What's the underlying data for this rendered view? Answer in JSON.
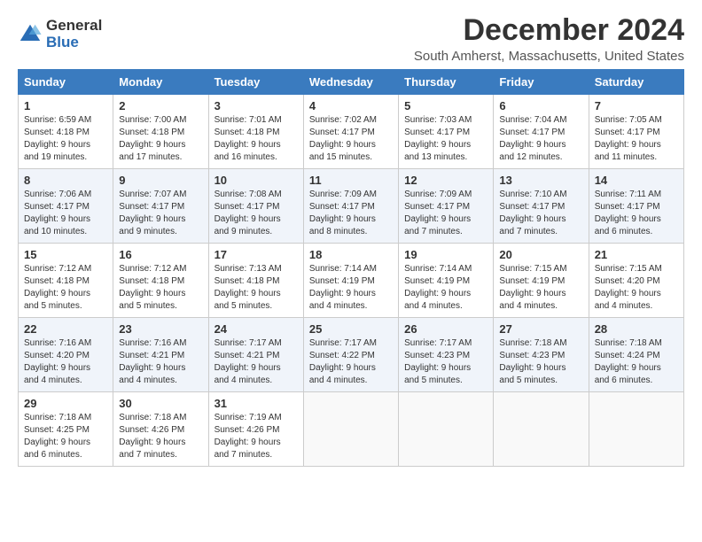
{
  "logo": {
    "general": "General",
    "blue": "Blue"
  },
  "title": "December 2024",
  "location": "South Amherst, Massachusetts, United States",
  "days_of_week": [
    "Sunday",
    "Monday",
    "Tuesday",
    "Wednesday",
    "Thursday",
    "Friday",
    "Saturday"
  ],
  "weeks": [
    [
      {
        "day": "1",
        "sunrise": "6:59 AM",
        "sunset": "4:18 PM",
        "daylight": "9 hours and 19 minutes."
      },
      {
        "day": "2",
        "sunrise": "7:00 AM",
        "sunset": "4:18 PM",
        "daylight": "9 hours and 17 minutes."
      },
      {
        "day": "3",
        "sunrise": "7:01 AM",
        "sunset": "4:18 PM",
        "daylight": "9 hours and 16 minutes."
      },
      {
        "day": "4",
        "sunrise": "7:02 AM",
        "sunset": "4:17 PM",
        "daylight": "9 hours and 15 minutes."
      },
      {
        "day": "5",
        "sunrise": "7:03 AM",
        "sunset": "4:17 PM",
        "daylight": "9 hours and 13 minutes."
      },
      {
        "day": "6",
        "sunrise": "7:04 AM",
        "sunset": "4:17 PM",
        "daylight": "9 hours and 12 minutes."
      },
      {
        "day": "7",
        "sunrise": "7:05 AM",
        "sunset": "4:17 PM",
        "daylight": "9 hours and 11 minutes."
      }
    ],
    [
      {
        "day": "8",
        "sunrise": "7:06 AM",
        "sunset": "4:17 PM",
        "daylight": "9 hours and 10 minutes."
      },
      {
        "day": "9",
        "sunrise": "7:07 AM",
        "sunset": "4:17 PM",
        "daylight": "9 hours and 9 minutes."
      },
      {
        "day": "10",
        "sunrise": "7:08 AM",
        "sunset": "4:17 PM",
        "daylight": "9 hours and 9 minutes."
      },
      {
        "day": "11",
        "sunrise": "7:09 AM",
        "sunset": "4:17 PM",
        "daylight": "9 hours and 8 minutes."
      },
      {
        "day": "12",
        "sunrise": "7:09 AM",
        "sunset": "4:17 PM",
        "daylight": "9 hours and 7 minutes."
      },
      {
        "day": "13",
        "sunrise": "7:10 AM",
        "sunset": "4:17 PM",
        "daylight": "9 hours and 7 minutes."
      },
      {
        "day": "14",
        "sunrise": "7:11 AM",
        "sunset": "4:17 PM",
        "daylight": "9 hours and 6 minutes."
      }
    ],
    [
      {
        "day": "15",
        "sunrise": "7:12 AM",
        "sunset": "4:18 PM",
        "daylight": "9 hours and 5 minutes."
      },
      {
        "day": "16",
        "sunrise": "7:12 AM",
        "sunset": "4:18 PM",
        "daylight": "9 hours and 5 minutes."
      },
      {
        "day": "17",
        "sunrise": "7:13 AM",
        "sunset": "4:18 PM",
        "daylight": "9 hours and 5 minutes."
      },
      {
        "day": "18",
        "sunrise": "7:14 AM",
        "sunset": "4:19 PM",
        "daylight": "9 hours and 4 minutes."
      },
      {
        "day": "19",
        "sunrise": "7:14 AM",
        "sunset": "4:19 PM",
        "daylight": "9 hours and 4 minutes."
      },
      {
        "day": "20",
        "sunrise": "7:15 AM",
        "sunset": "4:19 PM",
        "daylight": "9 hours and 4 minutes."
      },
      {
        "day": "21",
        "sunrise": "7:15 AM",
        "sunset": "4:20 PM",
        "daylight": "9 hours and 4 minutes."
      }
    ],
    [
      {
        "day": "22",
        "sunrise": "7:16 AM",
        "sunset": "4:20 PM",
        "daylight": "9 hours and 4 minutes."
      },
      {
        "day": "23",
        "sunrise": "7:16 AM",
        "sunset": "4:21 PM",
        "daylight": "9 hours and 4 minutes."
      },
      {
        "day": "24",
        "sunrise": "7:17 AM",
        "sunset": "4:21 PM",
        "daylight": "9 hours and 4 minutes."
      },
      {
        "day": "25",
        "sunrise": "7:17 AM",
        "sunset": "4:22 PM",
        "daylight": "9 hours and 4 minutes."
      },
      {
        "day": "26",
        "sunrise": "7:17 AM",
        "sunset": "4:23 PM",
        "daylight": "9 hours and 5 minutes."
      },
      {
        "day": "27",
        "sunrise": "7:18 AM",
        "sunset": "4:23 PM",
        "daylight": "9 hours and 5 minutes."
      },
      {
        "day": "28",
        "sunrise": "7:18 AM",
        "sunset": "4:24 PM",
        "daylight": "9 hours and 6 minutes."
      }
    ],
    [
      {
        "day": "29",
        "sunrise": "7:18 AM",
        "sunset": "4:25 PM",
        "daylight": "9 hours and 6 minutes."
      },
      {
        "day": "30",
        "sunrise": "7:18 AM",
        "sunset": "4:26 PM",
        "daylight": "9 hours and 7 minutes."
      },
      {
        "day": "31",
        "sunrise": "7:19 AM",
        "sunset": "4:26 PM",
        "daylight": "9 hours and 7 minutes."
      },
      null,
      null,
      null,
      null
    ]
  ]
}
